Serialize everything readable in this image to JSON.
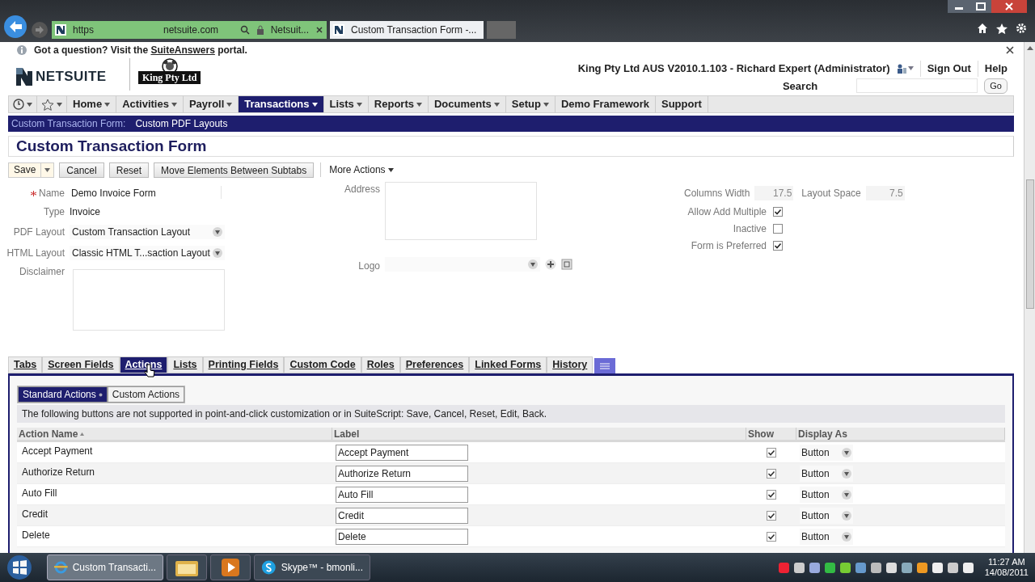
{
  "browser": {
    "address_scheme": "https",
    "address_host": "netsuite.com",
    "address_title": "Netsuit...",
    "tabs": [
      {
        "label": "Custom Transaction Form -...",
        "selected": true
      }
    ]
  },
  "info_bar": {
    "prefix": "Got a question? Visit the",
    "link": "SuiteAnswers",
    "suffix": "portal."
  },
  "header": {
    "brand": "NETSUITE",
    "company_logo": "King Pty Ltd",
    "account": "King Pty Ltd AUS V2010.1.103 - Richard Expert (Administrator)",
    "links": [
      "Sign Out",
      "Help"
    ],
    "search_label": "Search",
    "go_button": "Go"
  },
  "nav": [
    {
      "label": "Home",
      "dropdown": true,
      "selected": false
    },
    {
      "label": "Activities",
      "dropdown": true,
      "selected": false
    },
    {
      "label": "Payroll",
      "dropdown": true,
      "selected": false
    },
    {
      "label": "Transactions",
      "dropdown": true,
      "selected": true
    },
    {
      "label": "Lists",
      "dropdown": true,
      "selected": false
    },
    {
      "label": "Reports",
      "dropdown": true,
      "selected": false
    },
    {
      "label": "Documents",
      "dropdown": true,
      "selected": false
    },
    {
      "label": "Setup",
      "dropdown": true,
      "selected": false
    },
    {
      "label": "Demo Framework",
      "dropdown": false,
      "selected": false
    },
    {
      "label": "Support",
      "dropdown": false,
      "selected": false
    }
  ],
  "breadcrumb": [
    "Custom Transaction Form:",
    "Custom PDF Layouts"
  ],
  "title": "Custom Transaction Form",
  "toolbar": [
    {
      "label": "Save",
      "kind": "split"
    },
    {
      "label": "Cancel",
      "kind": "button"
    },
    {
      "label": "Reset",
      "kind": "button"
    },
    {
      "label": "Move Elements Between Subtabs",
      "kind": "button"
    },
    {
      "label": "More Actions",
      "kind": "menu"
    }
  ],
  "fields_left": [
    {
      "label": "Name",
      "value": "Demo Invoice Form",
      "kind": "text",
      "required": true
    },
    {
      "label": "Type",
      "value": "Invoice",
      "kind": "static",
      "required": false
    },
    {
      "label": "PDF Layout",
      "value": "Custom Transaction Layout",
      "kind": "select",
      "required": false
    },
    {
      "label": "HTML Layout",
      "value": "Classic HTML T...saction Layout",
      "kind": "select",
      "required": false
    },
    {
      "label": "Disclaimer",
      "kind": "textarea",
      "required": false
    }
  ],
  "address_label": "Address",
  "logo_label": "Logo",
  "columns_width": {
    "label": "Columns Width",
    "value": "17.5"
  },
  "layout_space": {
    "label": "Layout Space",
    "value": "7.5"
  },
  "checkboxes": [
    {
      "label": "Allow Add Multiple",
      "checked": true
    },
    {
      "label": "Inactive",
      "checked": false
    },
    {
      "label": "Form is Preferred",
      "checked": true
    }
  ],
  "subtabs": [
    {
      "label": "Tabs",
      "selected": false
    },
    {
      "label": "Screen Fields",
      "selected": false
    },
    {
      "label": "Actions",
      "selected": true
    },
    {
      "label": "Lists",
      "selected": false
    },
    {
      "label": "Printing Fields",
      "selected": false
    },
    {
      "label": "Custom Code",
      "selected": false
    },
    {
      "label": "Roles",
      "selected": false
    },
    {
      "label": "Preferences",
      "selected": false
    },
    {
      "label": "Linked Forms",
      "selected": false
    },
    {
      "label": "History",
      "selected": false
    }
  ],
  "inner_tabs": [
    {
      "label": "Standard Actions",
      "selected": true
    },
    {
      "label": "Custom Actions",
      "selected": false
    }
  ],
  "note": "The following buttons are not supported in point-and-click customization or in SuiteScript: Save, Cancel, Reset, Edit, Back.",
  "table": {
    "columns": [
      {
        "label": "Action Name",
        "sorted": true
      },
      {
        "label": "Label",
        "sorted": false
      },
      {
        "label": "Show",
        "sorted": false
      },
      {
        "label": "Display As",
        "sorted": false
      }
    ],
    "rows": [
      {
        "name": "Accept Payment",
        "label": "Accept Payment",
        "show": true,
        "display": "Button"
      },
      {
        "name": "Authorize Return",
        "label": "Authorize Return",
        "show": true,
        "display": "Button"
      },
      {
        "name": "Auto Fill",
        "label": "Auto Fill",
        "show": true,
        "display": "Button"
      },
      {
        "name": "Credit",
        "label": "Credit",
        "show": true,
        "display": "Button"
      },
      {
        "name": "Delete",
        "label": "Delete",
        "show": true,
        "display": "Button"
      }
    ]
  },
  "taskbar": {
    "items": [
      {
        "label": "Custom Transacti...",
        "kind": "browser",
        "selected": true
      },
      {
        "kind": "folder",
        "selected": false
      },
      {
        "kind": "media",
        "selected": false
      },
      {
        "label": "Skype™ - bmonli...",
        "kind": "skype",
        "selected": false
      }
    ],
    "time": "11:27 AM",
    "date": "14/08/2011"
  }
}
